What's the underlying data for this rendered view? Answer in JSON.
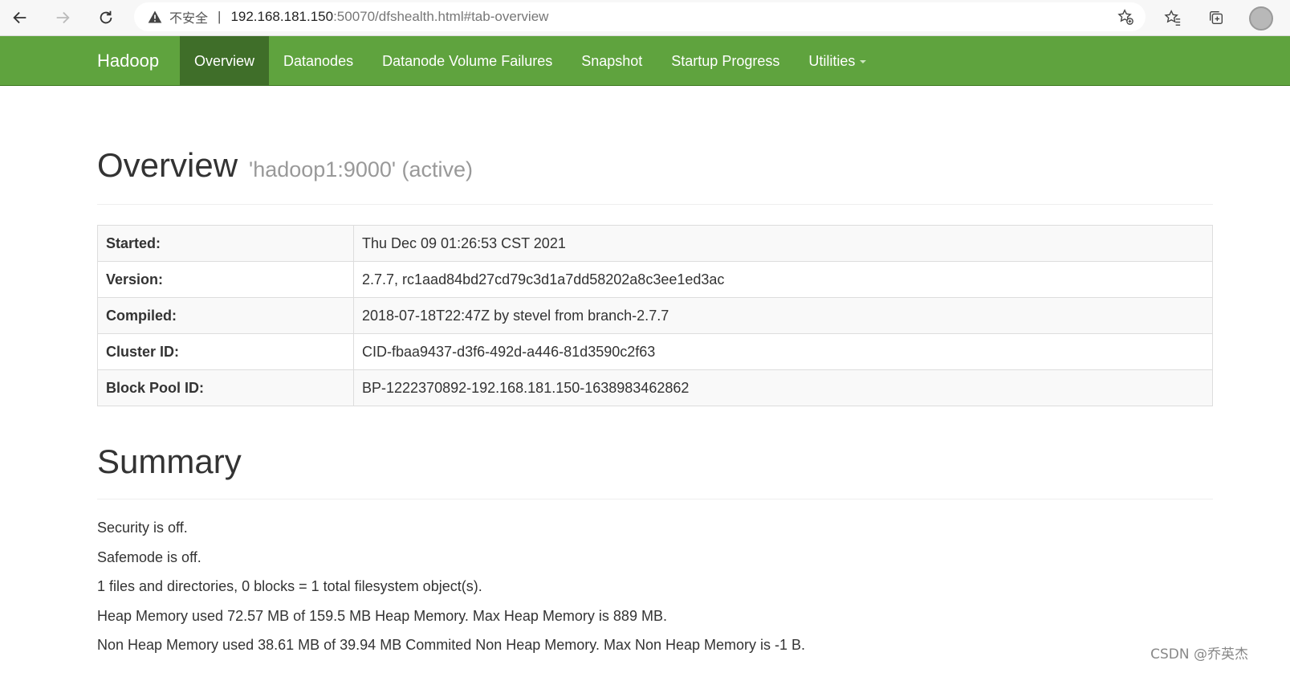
{
  "browser": {
    "insecure_label": "不安全",
    "separator": "|",
    "url_host": "192.168.181.150",
    "url_path": ":50070/dfshealth.html#tab-overview"
  },
  "navbar": {
    "brand": "Hadoop",
    "items": [
      {
        "label": "Overview",
        "active": true
      },
      {
        "label": "Datanodes",
        "active": false
      },
      {
        "label": "Datanode Volume Failures",
        "active": false
      },
      {
        "label": "Snapshot",
        "active": false
      },
      {
        "label": "Startup Progress",
        "active": false
      },
      {
        "label": "Utilities",
        "active": false,
        "dropdown": true
      }
    ],
    "color": "#5fa33e",
    "active_color": "#3f6e29"
  },
  "overview": {
    "title": "Overview",
    "subtitle": "'hadoop1:9000' (active)",
    "rows": [
      {
        "label": "Started:",
        "value": "Thu Dec 09 01:26:53 CST 2021"
      },
      {
        "label": "Version:",
        "value": "2.7.7, rc1aad84bd27cd79c3d1a7dd58202a8c3ee1ed3ac"
      },
      {
        "label": "Compiled:",
        "value": "2018-07-18T22:47Z by stevel from branch-2.7.7"
      },
      {
        "label": "Cluster ID:",
        "value": "CID-fbaa9437-d3f6-492d-a446-81d3590c2f63"
      },
      {
        "label": "Block Pool ID:",
        "value": "BP-1222370892-192.168.181.150-1638983462862"
      }
    ]
  },
  "summary": {
    "title": "Summary",
    "lines": [
      "Security is off.",
      "Safemode is off.",
      "1 files and directories, 0 blocks = 1 total filesystem object(s).",
      "Heap Memory used 72.57 MB of 159.5 MB Heap Memory. Max Heap Memory is 889 MB.",
      "Non Heap Memory used 38.61 MB of 39.94 MB Commited Non Heap Memory. Max Non Heap Memory is -1 B."
    ]
  },
  "watermark": "CSDN @乔英杰",
  "icons": [
    "back-arrow-icon",
    "forward-arrow-icon",
    "reload-icon",
    "warning-icon",
    "add-favorite-icon",
    "favorites-icon",
    "collections-icon",
    "profile-avatar",
    "dropdown-caret-icon"
  ]
}
